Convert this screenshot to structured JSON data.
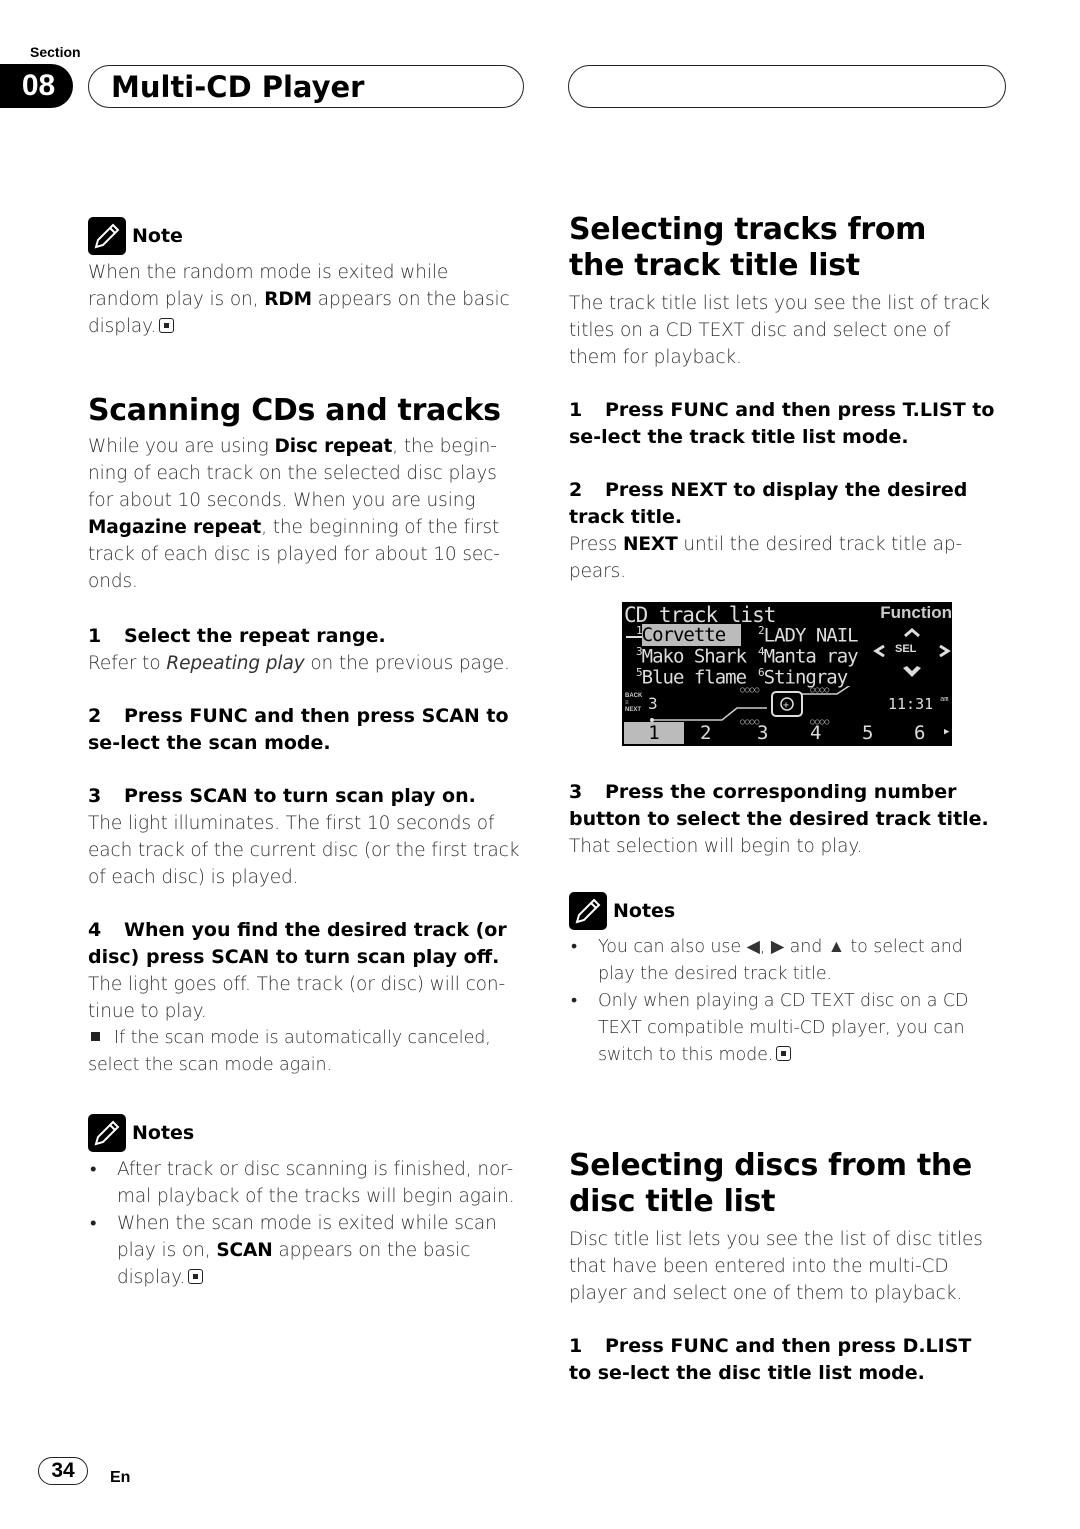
{
  "header": {
    "section_label": "Section",
    "section_number": "08",
    "title": "Multi-CD Player"
  },
  "left": {
    "note1": {
      "heading": "Note",
      "text_pre": "When the random mode is exited while random play is on, ",
      "text_bold": "RDM",
      "text_post": " appears on the basic display."
    },
    "scanning": {
      "heading": "Scanning CDs and tracks",
      "intro_1": "While you are using ",
      "intro_b1": "Disc repeat",
      "intro_2": ", the begin-ning of each track on the selected disc plays for about 10 seconds. When you are using ",
      "intro_b2": "Magazine repeat",
      "intro_3": ", the beginning of the first track of each disc is played for about 10 sec-onds.",
      "steps": [
        {
          "num": "1",
          "title": "Select the repeat range.",
          "desc_pre": "Refer to ",
          "desc_italic": "Repeating play",
          "desc_post": " on the previous page."
        },
        {
          "num": "2",
          "title": "Press FUNC and then press SCAN to se-lect the scan mode."
        },
        {
          "num": "3",
          "title": "Press SCAN to turn scan play on.",
          "desc": "The light illuminates. The first 10 seconds of each track of the current disc (or the first track of each disc) is played."
        },
        {
          "num": "4",
          "title": "When you find the desired track (or disc) press SCAN to turn scan play off.",
          "desc": "The light goes off. The track (or disc) will con-tinue to play.",
          "sub_note": "If the scan mode is automatically canceled, select the scan mode again."
        }
      ]
    },
    "notes2": {
      "heading": "Notes",
      "items": [
        "After track or disc scanning is finished, nor-mal playback of the tracks will begin again.",
        "When the scan mode is exited while scan play is on, "
      ],
      "item2_bold": "SCAN",
      "item2_post": " appears on the basic display."
    }
  },
  "right": {
    "tracks": {
      "heading": "Selecting tracks from the track title list",
      "intro": "The track title list lets you see the list of track titles on a CD TEXT disc and select one of them for playback.",
      "step1": {
        "num": "1",
        "title": "Press FUNC and then press T.LIST to se-lect the track title list mode."
      },
      "step2": {
        "num": "2",
        "title": "Press NEXT to display the desired track title.",
        "desc_pre": "Press ",
        "desc_bold": "NEXT",
        "desc_post": " until the desired track title ap-pears."
      },
      "step3": {
        "num": "3",
        "title": "Press the corresponding number button to select the desired track title.",
        "desc": "That selection will begin to play."
      }
    },
    "display": {
      "title": "CD track list",
      "function_label": "Function",
      "sel_label": "SEL",
      "tracks": [
        {
          "num": "1",
          "name": "Corvette",
          "selected": true
        },
        {
          "num": "2",
          "name": "LADY NAIL"
        },
        {
          "num": "3",
          "name": "Mako Shark"
        },
        {
          "num": "4",
          "name": "Manta ray"
        },
        {
          "num": "5",
          "name": "Blue flame"
        },
        {
          "num": "6",
          "name": "Stingray"
        }
      ],
      "back_label": "BACK",
      "next_label": "NEXT",
      "disc_number": "3",
      "clock": "11:31",
      "ampm": "am",
      "buttons": [
        "1",
        "2",
        "3",
        "4",
        "5",
        "6"
      ],
      "active_button": "1"
    },
    "notes3": {
      "heading": "Notes",
      "item1": "You can also use ◀, ▶ and ▲ to select and play the desired track title.",
      "item2": "Only when playing a CD TEXT disc on a CD TEXT compatible multi-CD player, you can switch to this mode."
    },
    "discs": {
      "heading": "Selecting discs from the disc title list",
      "intro": "Disc title list lets you see the list of disc titles that have been entered into the multi-CD player and select one of them to playback.",
      "step1": {
        "num": "1",
        "title": "Press FUNC and then press D.LIST to se-lect the disc title list mode."
      }
    }
  },
  "footer": {
    "page_number": "34",
    "language": "En"
  }
}
